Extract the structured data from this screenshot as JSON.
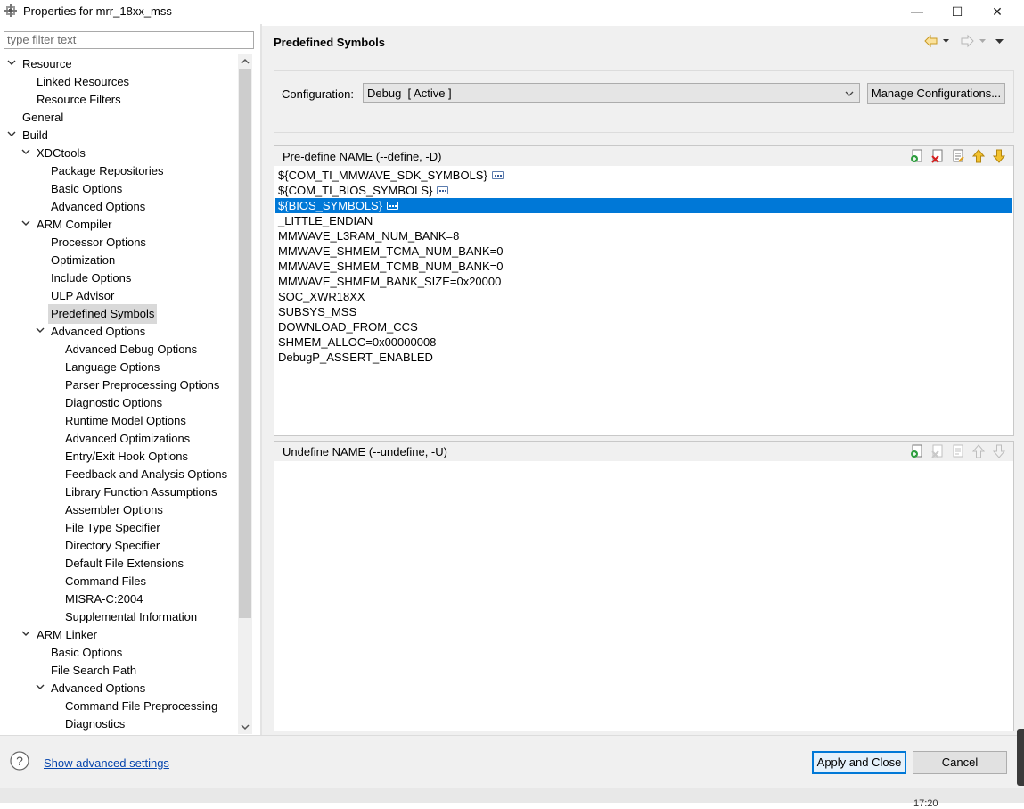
{
  "window": {
    "title": "Properties for mrr_18xx_mss",
    "minimize": "—",
    "maximize": "☐",
    "close": "✕"
  },
  "filter": {
    "placeholder": "type filter text"
  },
  "tree": [
    {
      "label": "Resource",
      "level": 0,
      "expand": "open"
    },
    {
      "label": "Linked Resources",
      "level": 1,
      "expand": ""
    },
    {
      "label": "Resource Filters",
      "level": 1,
      "expand": ""
    },
    {
      "label": "General",
      "level": 0,
      "expand": ""
    },
    {
      "label": "Build",
      "level": 0,
      "expand": "open"
    },
    {
      "label": "XDCtools",
      "level": 1,
      "expand": "open"
    },
    {
      "label": "Package Repositories",
      "level": 2,
      "expand": ""
    },
    {
      "label": "Basic Options",
      "level": 2,
      "expand": ""
    },
    {
      "label": "Advanced Options",
      "level": 2,
      "expand": ""
    },
    {
      "label": "ARM Compiler",
      "level": 1,
      "expand": "open"
    },
    {
      "label": "Processor Options",
      "level": 2,
      "expand": ""
    },
    {
      "label": "Optimization",
      "level": 2,
      "expand": ""
    },
    {
      "label": "Include Options",
      "level": 2,
      "expand": ""
    },
    {
      "label": "ULP Advisor",
      "level": 2,
      "expand": ""
    },
    {
      "label": "Predefined Symbols",
      "level": 2,
      "expand": "",
      "selected": true
    },
    {
      "label": "Advanced Options",
      "level": 2,
      "expand": "open"
    },
    {
      "label": "Advanced Debug Options",
      "level": 3,
      "expand": ""
    },
    {
      "label": "Language Options",
      "level": 3,
      "expand": ""
    },
    {
      "label": "Parser Preprocessing Options",
      "level": 3,
      "expand": ""
    },
    {
      "label": "Diagnostic Options",
      "level": 3,
      "expand": ""
    },
    {
      "label": "Runtime Model Options",
      "level": 3,
      "expand": ""
    },
    {
      "label": "Advanced Optimizations",
      "level": 3,
      "expand": ""
    },
    {
      "label": "Entry/Exit Hook Options",
      "level": 3,
      "expand": ""
    },
    {
      "label": "Feedback and Analysis Options",
      "level": 3,
      "expand": ""
    },
    {
      "label": "Library Function Assumptions",
      "level": 3,
      "expand": ""
    },
    {
      "label": "Assembler Options",
      "level": 3,
      "expand": ""
    },
    {
      "label": "File Type Specifier",
      "level": 3,
      "expand": ""
    },
    {
      "label": "Directory Specifier",
      "level": 3,
      "expand": ""
    },
    {
      "label": "Default File Extensions",
      "level": 3,
      "expand": ""
    },
    {
      "label": "Command Files",
      "level": 3,
      "expand": ""
    },
    {
      "label": "MISRA-C:2004",
      "level": 3,
      "expand": ""
    },
    {
      "label": "Supplemental Information",
      "level": 3,
      "expand": ""
    },
    {
      "label": "ARM Linker",
      "level": 1,
      "expand": "open"
    },
    {
      "label": "Basic Options",
      "level": 2,
      "expand": ""
    },
    {
      "label": "File Search Path",
      "level": 2,
      "expand": ""
    },
    {
      "label": "Advanced Options",
      "level": 2,
      "expand": "open"
    },
    {
      "label": "Command File Preprocessing",
      "level": 3,
      "expand": ""
    },
    {
      "label": "Diagnostics",
      "level": 3,
      "expand": ""
    }
  ],
  "page": {
    "title": "Predefined Symbols",
    "config_label": "Configuration:",
    "config_value": "Debug  [ Active ]",
    "manage_button": "Manage Configurations..."
  },
  "define_panel": {
    "header": "Pre-define NAME (--define, -D)",
    "items": [
      {
        "text": "${COM_TI_MMWAVE_SDK_SYMBOLS}",
        "ellipsis": true
      },
      {
        "text": "${COM_TI_BIOS_SYMBOLS}",
        "ellipsis": true
      },
      {
        "text": "${BIOS_SYMBOLS}",
        "ellipsis": true,
        "selected": true
      },
      {
        "text": "_LITTLE_ENDIAN",
        "ellipsis": false
      },
      {
        "text": "MMWAVE_L3RAM_NUM_BANK=8",
        "ellipsis": false
      },
      {
        "text": "MMWAVE_SHMEM_TCMA_NUM_BANK=0",
        "ellipsis": false
      },
      {
        "text": "MMWAVE_SHMEM_TCMB_NUM_BANK=0",
        "ellipsis": false
      },
      {
        "text": "MMWAVE_SHMEM_BANK_SIZE=0x20000",
        "ellipsis": false
      },
      {
        "text": "SOC_XWR18XX",
        "ellipsis": false
      },
      {
        "text": "SUBSYS_MSS",
        "ellipsis": false
      },
      {
        "text": "DOWNLOAD_FROM_CCS",
        "ellipsis": false
      },
      {
        "text": "SHMEM_ALLOC=0x00000008",
        "ellipsis": false
      },
      {
        "text": "DebugP_ASSERT_ENABLED",
        "ellipsis": false
      }
    ]
  },
  "undefine_panel": {
    "header": "Undefine NAME (--undefine, -U)",
    "items": []
  },
  "footer": {
    "advanced_link": "Show advanced settings",
    "apply_button": "Apply and Close",
    "cancel_button": "Cancel"
  },
  "taskbar": {
    "time": "17:20"
  }
}
